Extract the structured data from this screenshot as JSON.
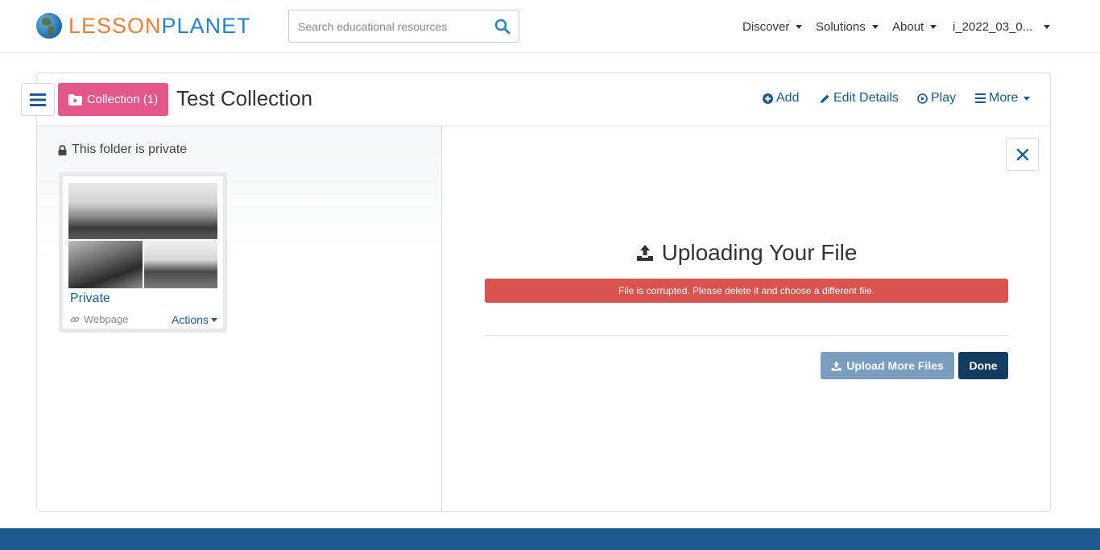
{
  "header": {
    "logo": {
      "part1": "LESSON",
      "part2": "PLANET"
    },
    "search": {
      "placeholder": "Search educational resources"
    },
    "nav": [
      {
        "label": "Discover"
      },
      {
        "label": "Solutions"
      },
      {
        "label": "About"
      },
      {
        "label": "i_2022_03_0..."
      }
    ]
  },
  "collection": {
    "badge_label": "Collection (1)",
    "title": "Test Collection",
    "actions": {
      "add": "Add",
      "edit": "Edit Details",
      "play": "Play",
      "more": "More"
    }
  },
  "folder": {
    "privacy_note": "This folder is private",
    "items": [
      {
        "title": "Private",
        "type": "Webpage",
        "actions_label": "Actions"
      }
    ]
  },
  "upload": {
    "title": "Uploading Your File",
    "error": "File is corrupted. Please delete it and choose a different file.",
    "upload_more_label": "Upload More Files",
    "done_label": "Done"
  },
  "colors": {
    "brand_orange": "#e8803a",
    "brand_blue": "#2a84c4",
    "link_blue": "#1d5a8e",
    "collection_pink": "#e5578a",
    "error_red": "#d9534f",
    "done_navy": "#143c5e"
  }
}
